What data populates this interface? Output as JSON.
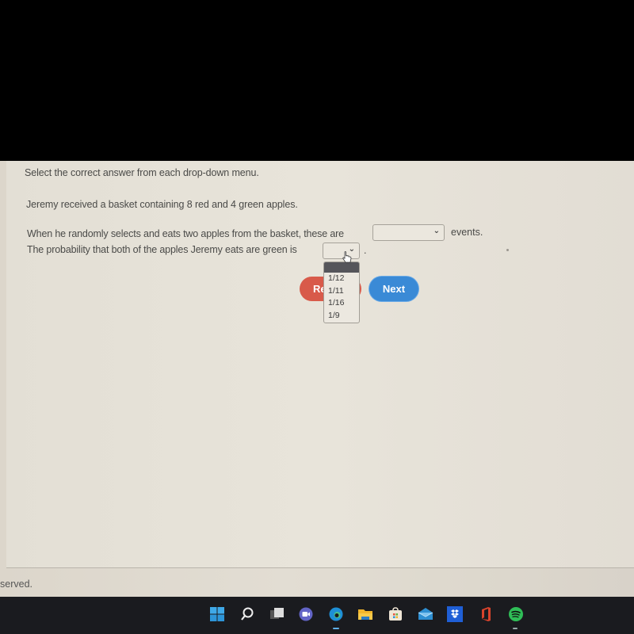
{
  "question": {
    "instructions": "Select the correct answer from each drop-down menu.",
    "prompt": "Jeremy received a basket containing 8 red and 4 green apples.",
    "sentence1_before": "When he randomly selects and eats two apples from the basket, these are",
    "sentence1_after": "events.",
    "sentence2_before": "The probability that both of the apples Jeremy eats are green is",
    "sentence2_after": ".",
    "dropdown1": {
      "selected": ""
    },
    "dropdown2": {
      "selected": "",
      "options": [
        "1/12",
        "1/11",
        "1/16",
        "1/9"
      ]
    }
  },
  "buttons": {
    "reset_label": "Re",
    "next_label": "Next"
  },
  "footer": {
    "text": "served."
  },
  "taskbar": {
    "icons": [
      "windows-start",
      "search",
      "task-view",
      "teams-chat",
      "edge",
      "file-explorer",
      "microsoft-store",
      "mail",
      "dropbox",
      "office",
      "spotify"
    ]
  },
  "colors": {
    "reset_button": "#d85a4a",
    "next_button": "#3a8ad6",
    "dropdown_highlight": "#55555a"
  }
}
